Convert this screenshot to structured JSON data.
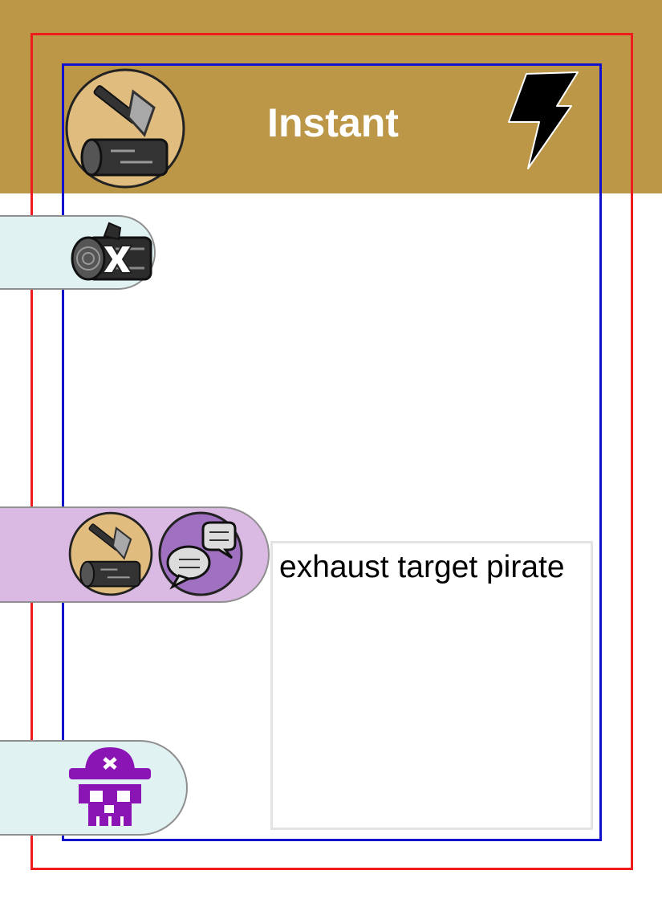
{
  "card": {
    "title": "Instant",
    "ability_text": "exhaust target pirate"
  },
  "colors": {
    "header": "#BC9748",
    "cut_line": "#ee1c1c",
    "safe_line": "#1212cc",
    "cost_pill": "#E1F2F2",
    "requirement_pill": "#DAB9E2",
    "target_pill": "#E1F2F2",
    "target_icon": "#8a14b4"
  },
  "icons": {
    "type": "woodcutting-icon",
    "speed": "lightning-bolt-icon",
    "cost": "log-exhaust-icon",
    "requirements": [
      "woodcutting-icon",
      "speech-bubbles-icon"
    ],
    "target": "pirate-skull-icon"
  }
}
